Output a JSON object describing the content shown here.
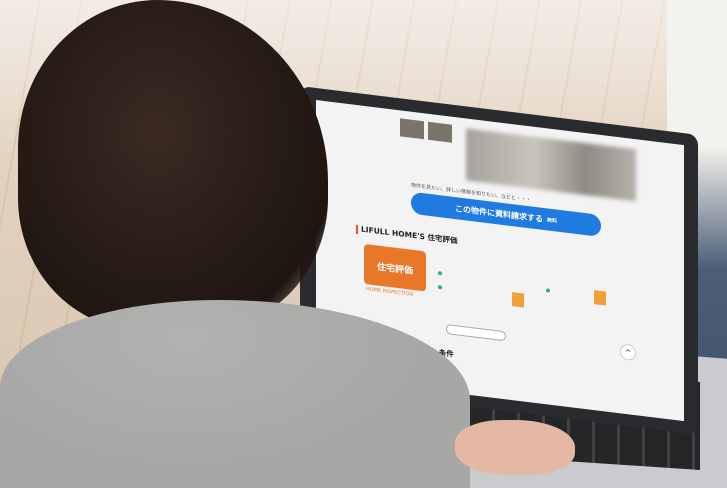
{
  "image": {
    "description_free": true
  },
  "screen": {
    "cta_main": "この物件に資料請求する",
    "cta_sub": "無料",
    "cta_prompt": "物件を見たい、詳しい情報を知りたい、などと・・・",
    "section_rating_title": "LIFULL HOME'S 住宅評価",
    "badge_text": "住宅評価",
    "badge_caption": "HOME INSPECTION",
    "section_features_title": "物件のこだわり/設備・条件"
  },
  "colors": {
    "accent_blue": "#1f7be0",
    "accent_orange": "#e8772a",
    "section_bar": "#e2531d"
  }
}
